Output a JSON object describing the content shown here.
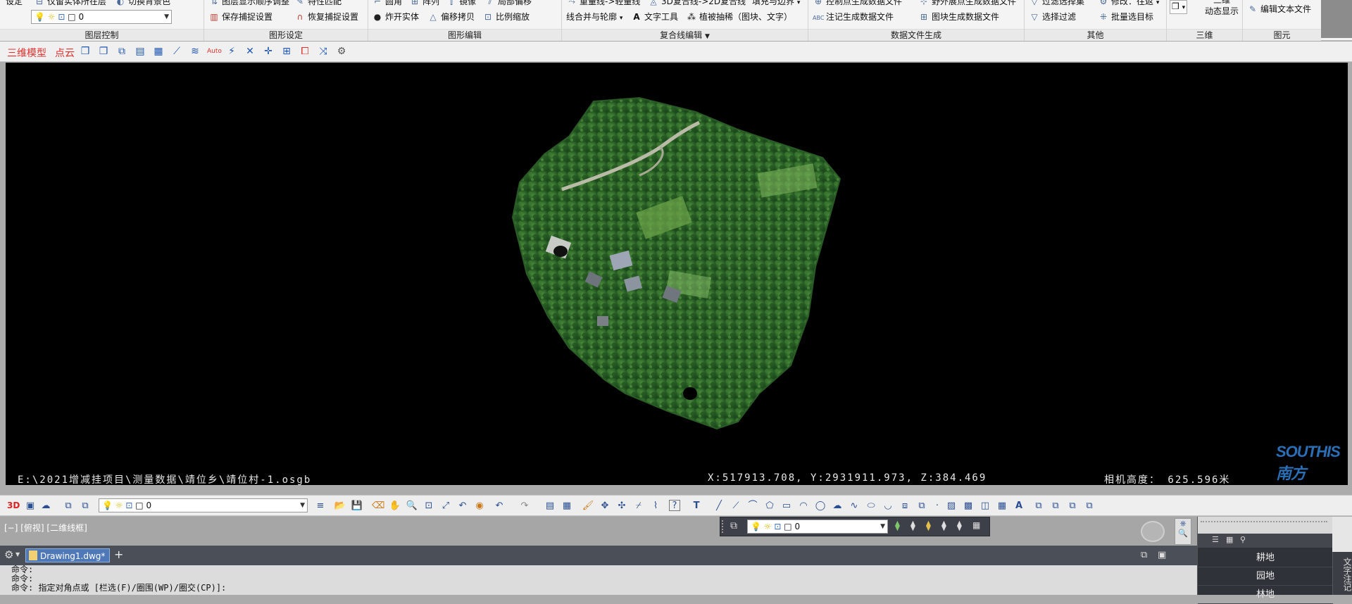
{
  "ribbon": {
    "panel_titles": [
      "图层控制",
      "图形设定",
      "图形编辑",
      "复合线编辑",
      "数据文件生成",
      "其他",
      "三维",
      "图元"
    ],
    "layer": {
      "top_left": "设定",
      "item1": "仅留实体所在层",
      "item2": "切换背景色",
      "combo_value": "0"
    },
    "shape_settings": {
      "item1": "图层显示顺序调整",
      "item2": "特性匹配",
      "item3": "保存捕捉设置",
      "item4": "恢复捕捉设置"
    },
    "shape_edit": {
      "item1": "圆角",
      "item2": "阵列",
      "item3": "镜像",
      "item4": "局部偏移",
      "item5": "炸开实体",
      "item6": "偏移拷贝",
      "item7": "比例缩放"
    },
    "polyline_edit": {
      "item1": "重量线->轻量线",
      "item2": "3D复合线->2D复合线",
      "item3": "填充与边界",
      "item4": "线合并与轮廓",
      "item5": "文字工具",
      "item6": "植被抽稀（图块、文字）"
    },
    "data_file": {
      "item1": "控制点生成数据文件",
      "item2": "野外展点生成数据文件",
      "item3": "注记生成数据文件",
      "item4": "图块生成数据文件"
    },
    "other": {
      "item1": "过滤选择集",
      "item2": "修改：往返",
      "item3": "选择过滤",
      "item4": "批量选目标"
    },
    "three_d": {
      "item1": "三维",
      "item2": "动态显示"
    },
    "primitive": {
      "item1": "编辑文本文件"
    }
  },
  "toolbar2": {
    "label_3d": "三维模型",
    "label_pc": "点云",
    "auto_label": "Auto"
  },
  "viewport": {
    "file_path": "E:\\2021增减挂项目\\测量数据\\靖位乡\\靖位村-1.osgb",
    "coords": "X:517913.708,  Y:2931911.973,  Z:384.469",
    "camera_height": "相机高度： 625.596米",
    "logo_text": "SOUTHIS南方"
  },
  "bottombar": {
    "label_3d": "3D",
    "layer_combo": "0"
  },
  "model_area": {
    "view_label": "[−] [俯视] [二维线框]",
    "layer_combo": "0"
  },
  "tabs": {
    "doc_tab": "Drawing1.dwg*",
    "add": "+"
  },
  "command": {
    "line1": "命令:",
    "line2": "命令:",
    "line3": "命令: 指定对角点或 [栏选(F)/圈围(WP)/圈交(CP)]:"
  },
  "right_panel": {
    "items": [
      "耕地",
      "园地",
      "林地"
    ],
    "vertical_tab": "文字注记"
  },
  "colors": {
    "viewport_bg": "#000000",
    "tab_accent": "#4f78b9",
    "red_label": "#e0302e"
  }
}
